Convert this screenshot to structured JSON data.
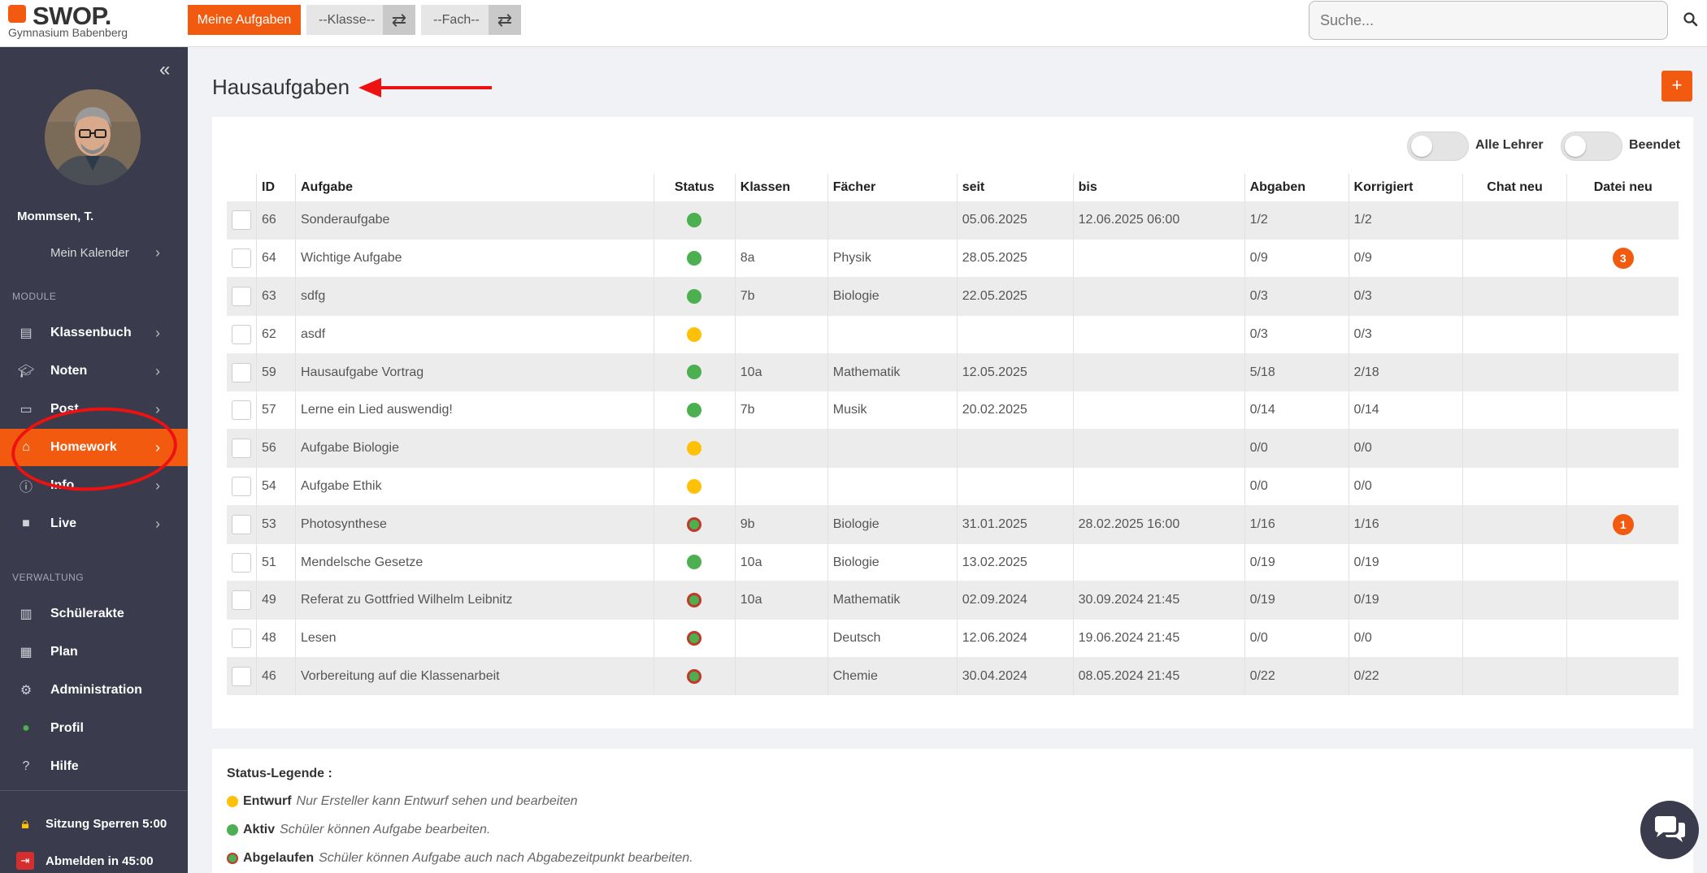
{
  "app": {
    "logo_text": "SWOP.",
    "school": "Gymnasium Babenberg",
    "brand_color": "#f15a0f"
  },
  "topbar": {
    "my_tasks_label": "Meine Aufgaben",
    "class_select": "--Klasse--",
    "subject_select": "--Fach--",
    "search_placeholder": "Suche..."
  },
  "sidebar": {
    "user_name": "Mommsen, T.",
    "calendar_label": "Mein Kalender",
    "section_modules": "MODULE",
    "modules": [
      {
        "label": "Klassenbuch",
        "icon": "book-icon"
      },
      {
        "label": "Noten",
        "icon": "graduation-cap-icon"
      },
      {
        "label": "Post",
        "icon": "message-icon"
      },
      {
        "label": "Homework",
        "icon": "home-icon",
        "active": true
      },
      {
        "label": "Info",
        "icon": "info-icon"
      },
      {
        "label": "Live",
        "icon": "video-icon"
      }
    ],
    "section_admin": "VERWALTUNG",
    "admin": [
      {
        "label": "Schülerakte",
        "icon": "folder-icon"
      },
      {
        "label": "Plan",
        "icon": "calendar-icon"
      },
      {
        "label": "Administration",
        "icon": "gears-icon"
      },
      {
        "label": "Profil",
        "icon": "user-icon"
      },
      {
        "label": "Hilfe",
        "icon": "question-icon"
      }
    ],
    "lock_label": "Sitzung Sperren 5:00",
    "logout_label": "Abmelden in 45:00"
  },
  "main": {
    "title": "Hausaufgaben",
    "add_label": "+",
    "toggle_all_teachers": "Alle Lehrer",
    "toggle_finished": "Beendet"
  },
  "table": {
    "columns": [
      "ID",
      "Aufgabe",
      "Status",
      "Klassen",
      "Fächer",
      "seit",
      "bis",
      "Abgaben",
      "Korrigiert",
      "Chat neu",
      "Datei neu"
    ],
    "rows": [
      {
        "id": "66",
        "task": "Sonderaufgabe",
        "status": "green",
        "classes": "",
        "subject": "",
        "since": "05.06.2025",
        "until": "12.06.2025 06:00",
        "submissions": "1/2",
        "corrected": "1/2",
        "chat": "",
        "file": ""
      },
      {
        "id": "64",
        "task": "Wichtige Aufgabe",
        "status": "green",
        "classes": "8a",
        "subject": "Physik",
        "since": "28.05.2025",
        "until": "",
        "submissions": "0/9",
        "corrected": "0/9",
        "chat": "",
        "file": "3"
      },
      {
        "id": "63",
        "task": "sdfg",
        "status": "green",
        "classes": "7b",
        "subject": "Biologie",
        "since": "22.05.2025",
        "until": "",
        "submissions": "0/3",
        "corrected": "0/3",
        "chat": "",
        "file": ""
      },
      {
        "id": "62",
        "task": "asdf",
        "status": "yellow",
        "classes": "",
        "subject": "",
        "since": "",
        "until": "",
        "submissions": "0/3",
        "corrected": "0/3",
        "chat": "",
        "file": ""
      },
      {
        "id": "59",
        "task": "Hausaufgabe Vortrag",
        "status": "green",
        "classes": "10a",
        "subject": "Mathematik",
        "since": "12.05.2025",
        "until": "",
        "submissions": "5/18",
        "corrected": "2/18",
        "chat": "",
        "file": ""
      },
      {
        "id": "57",
        "task": "Lerne ein Lied auswendig!",
        "status": "green",
        "classes": "7b",
        "subject": "Musik",
        "since": "20.02.2025",
        "until": "",
        "submissions": "0/14",
        "corrected": "0/14",
        "chat": "",
        "file": ""
      },
      {
        "id": "56",
        "task": "Aufgabe Biologie",
        "status": "yellow",
        "classes": "",
        "subject": "",
        "since": "",
        "until": "",
        "submissions": "0/0",
        "corrected": "0/0",
        "chat": "",
        "file": ""
      },
      {
        "id": "54",
        "task": "Aufgabe Ethik",
        "status": "yellow",
        "classes": "",
        "subject": "",
        "since": "",
        "until": "",
        "submissions": "0/0",
        "corrected": "0/0",
        "chat": "",
        "file": ""
      },
      {
        "id": "53",
        "task": "Photosynthese",
        "status": "expired",
        "classes": "9b",
        "subject": "Biologie",
        "since": "31.01.2025",
        "until": "28.02.2025 16:00",
        "submissions": "1/16",
        "corrected": "1/16",
        "chat": "",
        "file": "1"
      },
      {
        "id": "51",
        "task": "Mendelsche Gesetze",
        "status": "green",
        "classes": "10a",
        "subject": "Biologie",
        "since": "13.02.2025",
        "until": "",
        "submissions": "0/19",
        "corrected": "0/19",
        "chat": "",
        "file": ""
      },
      {
        "id": "49",
        "task": "Referat zu Gottfried Wilhelm Leibnitz",
        "status": "expired",
        "classes": "10a",
        "subject": "Mathematik",
        "since": "02.09.2024",
        "until": "30.09.2024 21:45",
        "submissions": "0/19",
        "corrected": "0/19",
        "chat": "",
        "file": ""
      },
      {
        "id": "48",
        "task": "Lesen",
        "status": "expired",
        "classes": "",
        "subject": "Deutsch",
        "since": "12.06.2024",
        "until": "19.06.2024 21:45",
        "submissions": "0/0",
        "corrected": "0/0",
        "chat": "",
        "file": ""
      },
      {
        "id": "46",
        "task": "Vorbereitung auf die Klassenarbeit",
        "status": "expired",
        "classes": "",
        "subject": "Chemie",
        "since": "30.04.2024",
        "until": "08.05.2024 21:45",
        "submissions": "0/22",
        "corrected": "0/22",
        "chat": "",
        "file": ""
      }
    ]
  },
  "legend": {
    "title": "Status-Legende :",
    "items": [
      {
        "status": "yellow",
        "name": "Entwurf",
        "desc": "Nur Ersteller kann Entwurf sehen und bearbeiten"
      },
      {
        "status": "green",
        "name": "Aktiv",
        "desc": "Schüler können Aufgabe bearbeiten."
      },
      {
        "status": "expired",
        "name": "Abgelaufen",
        "desc": "Schüler können Aufgabe auch nach Abgabezeitpunkt bearbeiten."
      }
    ]
  }
}
